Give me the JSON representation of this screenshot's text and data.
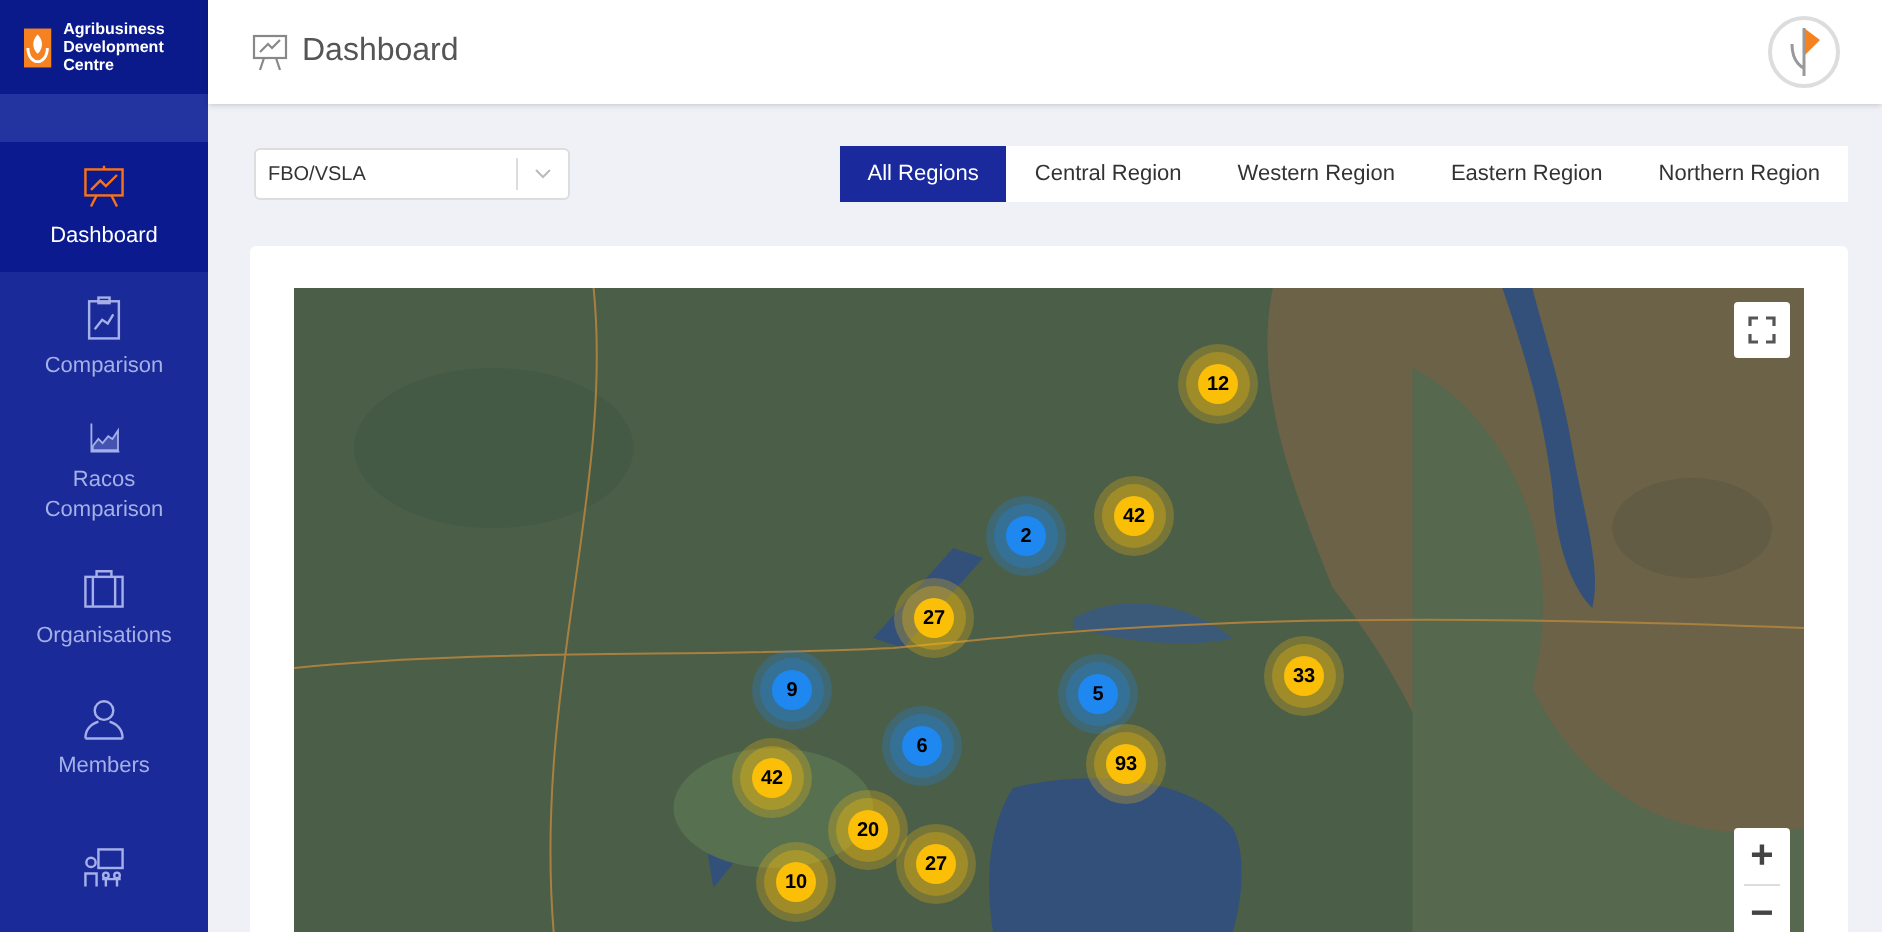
{
  "brand": {
    "name": "Agribusiness Development Centre"
  },
  "header": {
    "title": "Dashboard"
  },
  "sidebar": {
    "items": [
      {
        "label": "Dashboard",
        "selected": true
      },
      {
        "label": "Comparison",
        "selected": false
      },
      {
        "label": "Racos Comparison",
        "selected": false
      },
      {
        "label": "Organisations",
        "selected": false
      },
      {
        "label": "Members",
        "selected": false
      },
      {
        "selected": false
      }
    ]
  },
  "filter": {
    "value": "FBO/VSLA"
  },
  "tabs": [
    {
      "label": "All Regions",
      "selected": true
    },
    {
      "label": "Central Region",
      "selected": false
    },
    {
      "label": "Western Region",
      "selected": false
    },
    {
      "label": "Eastern Region",
      "selected": false
    },
    {
      "label": "Northern Region",
      "selected": false
    }
  ],
  "map": {
    "zoom_in": "+",
    "zoom_out": "−",
    "markers": [
      {
        "count": "12",
        "color": "#fbbf08"
      },
      {
        "count": "42",
        "color": "#fbbf08"
      },
      {
        "count": "2",
        "color": "#1e88f0"
      },
      {
        "count": "27",
        "color": "#fbbf08"
      },
      {
        "count": "9",
        "color": "#1e88f0"
      },
      {
        "count": "5",
        "color": "#1e88f0"
      },
      {
        "count": "33",
        "color": "#fbbf08"
      },
      {
        "count": "6",
        "color": "#1e88f0"
      },
      {
        "count": "93",
        "color": "#fbbf08"
      },
      {
        "count": "42",
        "color": "#fbbf08"
      },
      {
        "count": "20",
        "color": "#fbbf08"
      },
      {
        "count": "27",
        "color": "#fbbf08"
      },
      {
        "count": "10",
        "color": "#fbbf08"
      }
    ]
  }
}
